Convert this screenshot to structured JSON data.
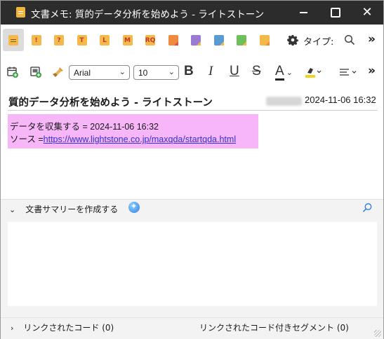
{
  "window": {
    "title": "文書メモ: 質的データ分析を始めよう - ライトストーン"
  },
  "toolbar1": {
    "code_icons": [
      {
        "label": "",
        "color": "#f5b84b",
        "selected": true,
        "lines": true
      },
      {
        "label": "!",
        "color": "#f5b84b"
      },
      {
        "label": "?",
        "color": "#f5b84b"
      },
      {
        "label": "T",
        "color": "#f5b84b"
      },
      {
        "label": "L",
        "color": "#f5b84b"
      },
      {
        "label": "M",
        "color": "#f5b84b"
      },
      {
        "label": "RQ",
        "color": "#f5b84b"
      },
      {
        "label": "",
        "color": "#f08a3c",
        "corner": "#d9534f"
      },
      {
        "label": "",
        "color": "#9b7ad6",
        "corner": "#f5b84b"
      },
      {
        "label": "",
        "color": "#5b9bd5",
        "corner": "#f5b84b"
      },
      {
        "label": "",
        "color": "#6cbf5a",
        "corner": "#f5b84b"
      },
      {
        "label": "",
        "color": "#f5b84b",
        "corner": "#f08a3c"
      }
    ],
    "type_label": "タイプ:"
  },
  "toolbar2": {
    "font_family": "Arial",
    "font_size": "10"
  },
  "document": {
    "title": "質的データ分析を始めよう - ライトストーン",
    "date": "2024-11-06 16:32",
    "memo_line1": "データを収集する = 2024-11-06 16:32",
    "memo_line2_prefix": "ソース =",
    "memo_link": "https://www.lightstone.co.jp/maxqda/startqda.html"
  },
  "summary": {
    "header": "文書サマリーを作成する"
  },
  "footer": {
    "linked_codes": "リンクされたコード (0)",
    "linked_segments": "リンクされたコード付きセグメント (0)"
  },
  "colors": {
    "titlebar": "#2c2c2c",
    "memo_highlight": "#f7b6f7",
    "link": "#3333cc"
  }
}
